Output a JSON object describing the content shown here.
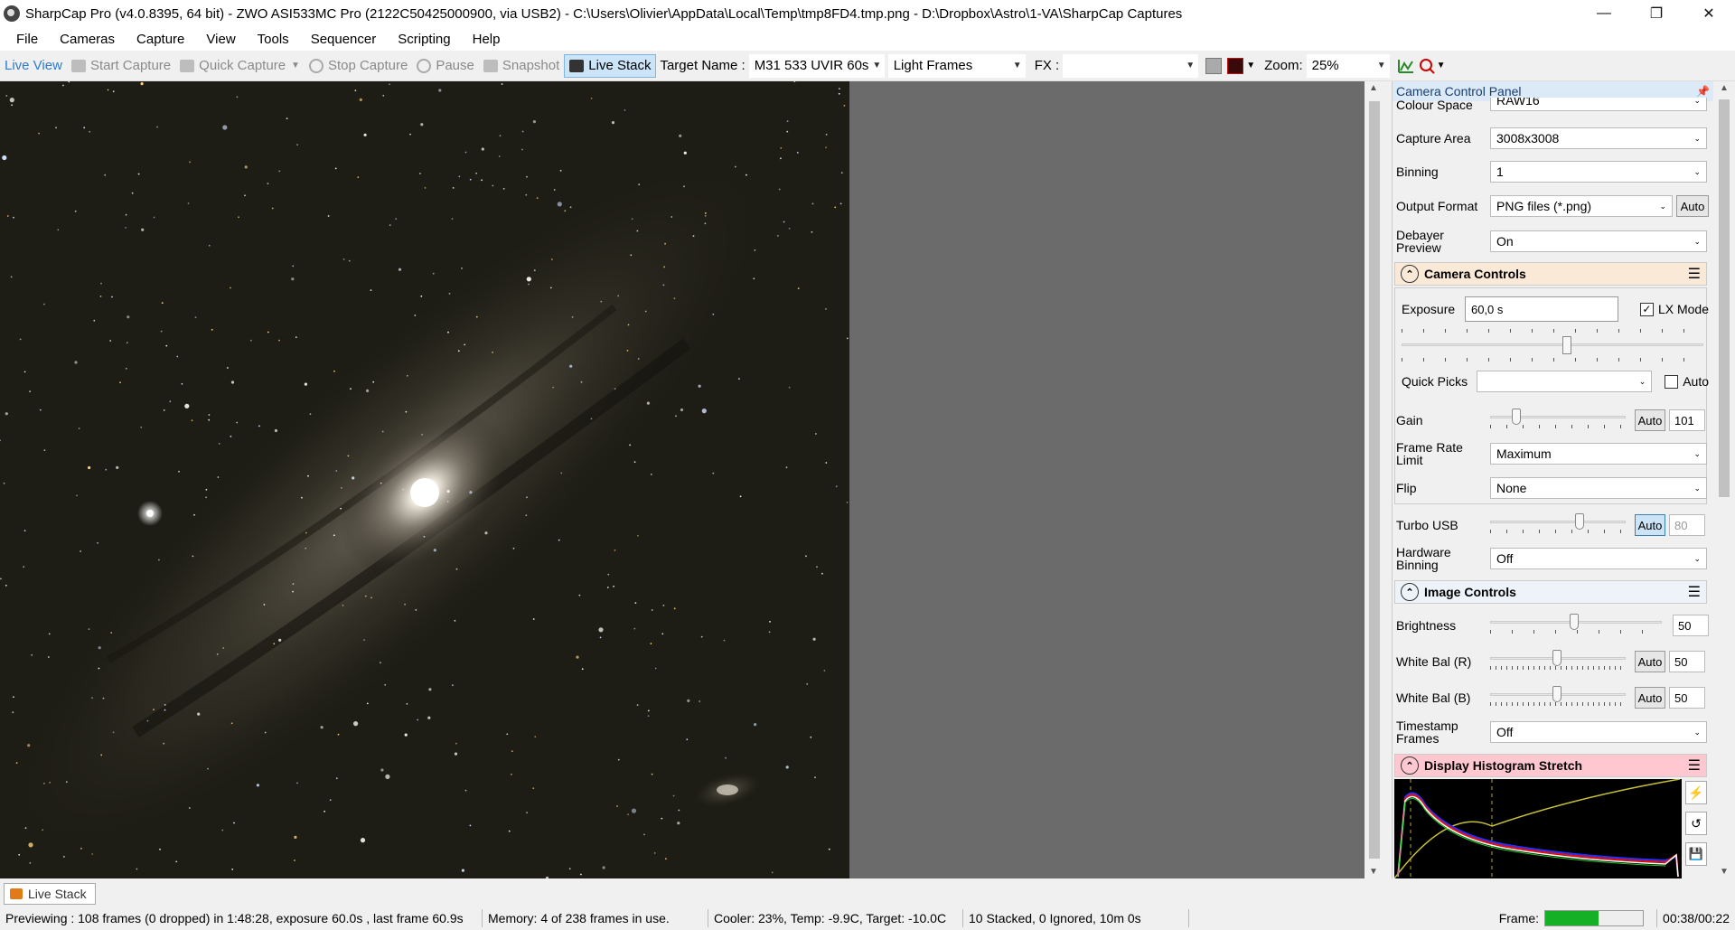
{
  "window": {
    "title": "SharpCap Pro (v4.0.8395, 64 bit) - ZWO ASI533MC Pro (2122C50425000900, via USB2) - C:\\Users\\Olivier\\AppData\\Local\\Temp\\tmp8FD4.tmp.png - D:\\Dropbox\\Astro\\1-VA\\SharpCap Captures",
    "minimize": "—",
    "restore": "❐",
    "close": "✕"
  },
  "menu": [
    "File",
    "Cameras",
    "Capture",
    "View",
    "Tools",
    "Sequencer",
    "Scripting",
    "Help"
  ],
  "toolbar": {
    "live_view": "Live View",
    "start_capture": "Start Capture",
    "quick_capture": "Quick Capture",
    "stop_capture": "Stop Capture",
    "pause": "Pause",
    "snapshot": "Snapshot",
    "live_stack": "Live Stack",
    "target_name_label": "Target Name :",
    "target_name_value": "M31 533 UVIR 60s",
    "frame_type": "Light Frames",
    "fx_label": "FX :",
    "fx_value": "",
    "zoom_label": "Zoom:",
    "zoom_value": "25%"
  },
  "panel": {
    "title": "Camera Control Panel",
    "pin_icon": "pin-icon",
    "colour_space": {
      "label": "Colour Space",
      "value": "RAW16"
    },
    "capture_area": {
      "label": "Capture Area",
      "value": "3008x3008"
    },
    "binning": {
      "label": "Binning",
      "value": "1"
    },
    "output_format": {
      "label": "Output Format",
      "value": "PNG files (*.png)",
      "auto": "Auto"
    },
    "debayer": {
      "label": "Debayer Preview",
      "value": "On"
    },
    "camera_controls": {
      "title": "Camera Controls",
      "exposure_label": "Exposure",
      "exposure_value": "60,0 s",
      "lx_mode": "LX Mode",
      "lx_checked": true,
      "exposure_slider": 0.55,
      "quick_picks_label": "Quick Picks",
      "quick_picks_value": "",
      "quick_picks_auto": "Auto",
      "gain": {
        "label": "Gain",
        "auto": "Auto",
        "value": "101",
        "slider": 0.17
      },
      "frame_rate": {
        "label": "Frame Rate Limit",
        "value": "Maximum"
      },
      "flip": {
        "label": "Flip",
        "value": "None"
      },
      "turbo": {
        "label": "Turbo USB",
        "auto": "Auto",
        "value": "80",
        "slider": 0.67
      },
      "hw_binning": {
        "label": "Hardware Binning",
        "value": "Off"
      }
    },
    "image_controls": {
      "title": "Image Controls",
      "brightness": {
        "label": "Brightness",
        "value": "50",
        "slider": 0.49
      },
      "wb_r": {
        "label": "White Bal (R)",
        "auto": "Auto",
        "value": "50",
        "slider": 0.49
      },
      "wb_b": {
        "label": "White Bal (B)",
        "auto": "Auto",
        "value": "50",
        "slider": 0.49
      },
      "timestamp": {
        "label": "Timestamp Frames",
        "value": "Off"
      }
    },
    "histogram": {
      "title": "Display Histogram Stretch"
    }
  },
  "status": {
    "tab": "Live Stack",
    "previewing": "Previewing : 108 frames (0 dropped) in 1:48:28, exposure 60.0s , last frame 60.9s",
    "memory": "Memory: 4 of 238 frames in use.",
    "cooler": "Cooler: 23%, Temp: -9.9C, Target: -10.0C",
    "stacked": "10 Stacked, 0 Ignored, 10m 0s",
    "frame_label": "Frame:",
    "frame_progress": 0.55,
    "time": "00:38/00:22"
  },
  "colors": {
    "accent": "#cce4f7",
    "histogram_header": "#ffc8d0",
    "camera_header": "#fbe9d7",
    "frame_fill": "#16b026"
  }
}
